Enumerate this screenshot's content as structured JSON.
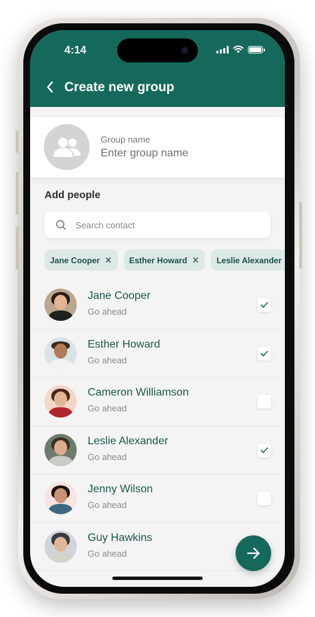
{
  "status_bar": {
    "time": "4:14",
    "battery_level": 1.0
  },
  "header": {
    "title": "Create new group",
    "back_icon": "chevron-left-icon"
  },
  "group": {
    "label": "Group name",
    "placeholder": "Enter group name",
    "avatar_icon": "group-icon"
  },
  "section_title": "Add people",
  "search": {
    "placeholder": "Search contact",
    "icon": "search-icon"
  },
  "chips": [
    {
      "label": "Jane Cooper"
    },
    {
      "label": "Esther Howard"
    },
    {
      "label": "Leslie Alexander"
    }
  ],
  "contacts": [
    {
      "name": "Jane Cooper",
      "status": "Go ahead",
      "checked": true
    },
    {
      "name": "Esther Howard",
      "status": "Go ahead",
      "checked": true
    },
    {
      "name": "Cameron Williamson",
      "status": "Go ahead",
      "checked": false
    },
    {
      "name": "Leslie Alexander",
      "status": "Go ahead",
      "checked": true
    },
    {
      "name": "Jenny Wilson",
      "status": "Go ahead",
      "checked": false
    },
    {
      "name": "Guy Hawkins",
      "status": "Go ahead",
      "checked": false
    }
  ],
  "fab": {
    "icon": "arrow-right-icon"
  },
  "colors": {
    "accent": "#15695b",
    "chip_bg": "#dde9e6",
    "name_text": "#17574d"
  }
}
